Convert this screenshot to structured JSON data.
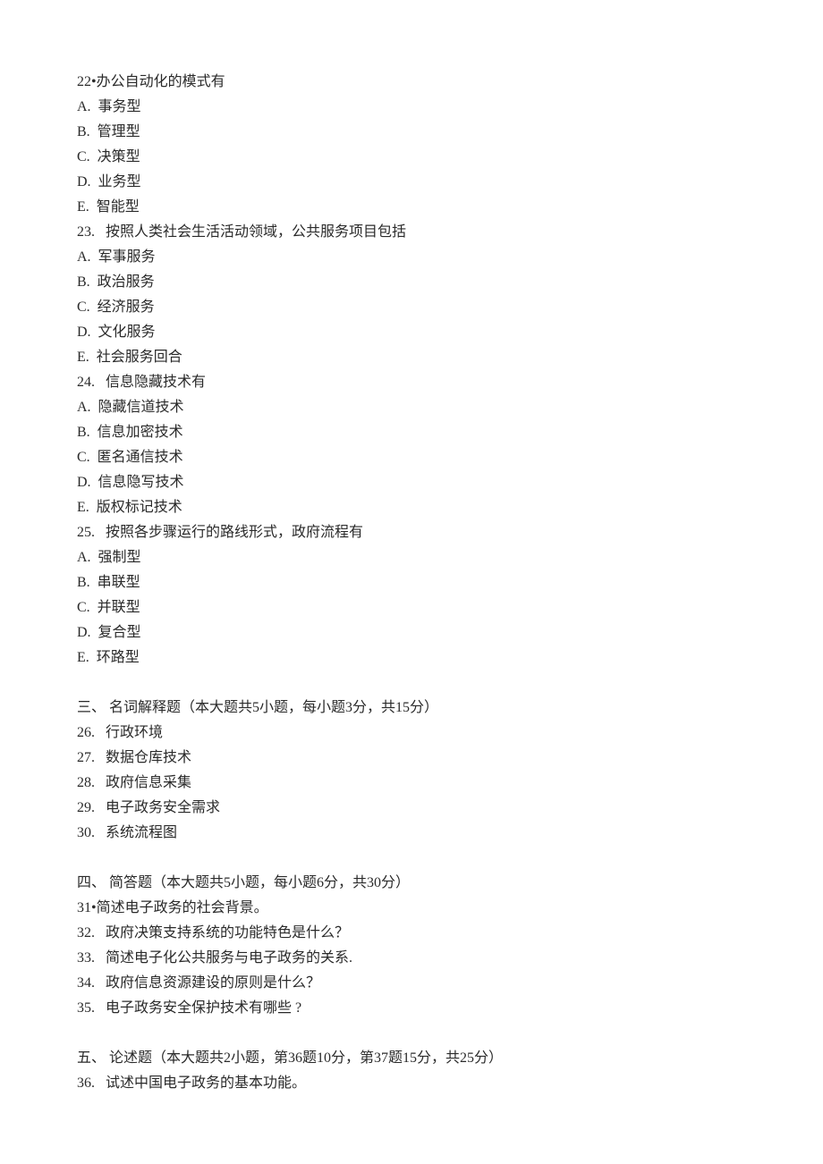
{
  "questions_mc": [
    {
      "prompt": "22•办公自动化的模式有",
      "options": [
        "A.  事务型",
        "B.  管理型",
        "C.  决策型",
        "D.  业务型",
        "E.  智能型"
      ]
    },
    {
      "prompt": "23.   按照人类社会生活活动领域，公共服务项目包括",
      "options": [
        "A.  军事服务",
        "B.  政治服务",
        "C.  经济服务",
        "D.  文化服务",
        "E.  社会服务回合"
      ]
    },
    {
      "prompt": "24.   信息隐藏技术有",
      "options": [
        "A.  隐藏信道技术",
        "B.  信息加密技术",
        "C.  匿名通信技术",
        "D.  信息隐写技术",
        "E.  版权标记技术"
      ]
    },
    {
      "prompt": "25.   按照各步骤运行的路线形式，政府流程有",
      "options": [
        "A.  强制型",
        "B.  串联型",
        "C.  并联型",
        "D.  复合型",
        "E.  环路型"
      ]
    }
  ],
  "section3": {
    "heading": "三、 名词解释题（本大题共5小题，每小题3分，共15分）",
    "items": [
      "26.   行政环境",
      "27.   数据仓库技术",
      "28.   政府信息采集",
      "29.   电子政务安全需求",
      "30.   系统流程图"
    ]
  },
  "section4": {
    "heading": "四、 简答题（本大题共5小题，每小题6分，共30分）",
    "items": [
      "31•简述电子政务的社会背景。",
      "32.   政府决策支持系统的功能特色是什么？",
      "33.   简述电子化公共服务与电子政务的关系.",
      "34.   政府信息资源建设的原则是什么？",
      "35.   电子政务安全保护技术有哪些 ?"
    ]
  },
  "section5": {
    "heading": "五、 论述题（本大题共2小题，第36题10分，第37题15分，共25分）",
    "items": [
      "36.   试述中国电子政务的基本功能。"
    ]
  }
}
